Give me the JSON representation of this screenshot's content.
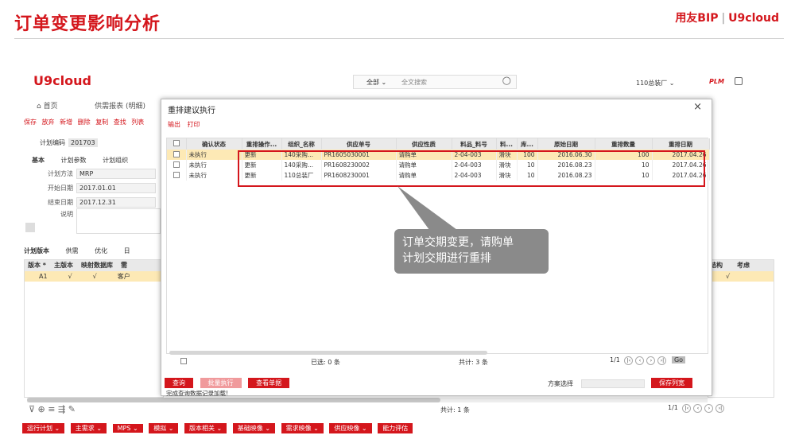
{
  "slide": {
    "title": "订单变更影响分析",
    "brand": "用友BIP",
    "brand_sep": "|",
    "brand2": "U9cloud"
  },
  "app": {
    "logo": "U9cloud",
    "search_scope": "全部 ⌄",
    "search_placeholder": "全文搜索",
    "org": "110总装厂 ⌄",
    "plm": "PLM",
    "nav": [
      "首页",
      "供需报表 (明细)"
    ],
    "toolbar": [
      "保存",
      "放弃",
      "新增",
      "删除",
      "复制",
      "查找",
      "列表"
    ],
    "plan_code_label": "计划编码",
    "plan_code": "201703",
    "tabs1": [
      "基本",
      "计划参数",
      "计划组织"
    ],
    "form": {
      "method_label": "计划方法",
      "method": "MRP",
      "start_label": "开始日期",
      "start": "2017.01.01",
      "end_label": "结束日期",
      "end": "2017.12.31",
      "memo_label": "说明"
    },
    "tabs2": [
      "计划版本",
      "供需",
      "优化",
      "日"
    ],
    "left_grid": {
      "headers": [
        "版本 *",
        "主版本",
        "映射数据库",
        "需"
      ],
      "row": [
        "A1",
        "√",
        "√",
        "客户"
      ]
    },
    "right_grid": {
      "headers": [
        "结构",
        "考虑"
      ],
      "row": [
        "√"
      ]
    },
    "bottom_total": "共计: 1 条",
    "bottom_page": "1/1",
    "bottom_buttons": [
      "运行计划 ⌄",
      "主需求 ⌄",
      "MPS ⌄",
      "模拟 ⌄",
      "版本相关 ⌄",
      "基础映像 ⌄",
      "需求映像 ⌄",
      "供应映像 ⌄",
      "能力评估"
    ]
  },
  "dialog": {
    "title": "重排建议执行",
    "close": "×",
    "tools": [
      "输出",
      "打印"
    ],
    "columns": [
      "",
      "确认状态",
      "重排操作...",
      "组织_名称",
      "供应单号",
      "供应性质",
      "料品_料号",
      "料...",
      "库...",
      "原始日期",
      "重排数量",
      "重排日期"
    ],
    "rows": [
      [
        "",
        "未执行",
        "更新",
        "140采购...",
        "PR1605030001",
        "请购单",
        "2-04-003",
        "滑块",
        "100",
        "2016.06.30",
        "100",
        "2017.04.26"
      ],
      [
        "",
        "未执行",
        "更新",
        "140采购...",
        "PR1608230002",
        "请购单",
        "2-04-003",
        "滑块",
        "10",
        "2016.08.23",
        "10",
        "2017.04.26"
      ],
      [
        "",
        "未执行",
        "更新",
        "110总装厂",
        "PR1608230001",
        "请购单",
        "2-04-003",
        "滑块",
        "10",
        "2016.08.23",
        "10",
        "2017.04.26"
      ]
    ],
    "selected": "已选: 0 条",
    "total": "共计: 3 条",
    "page": "1/1",
    "go": "Go",
    "buttons": [
      "查询",
      "批量执行",
      "查看单据"
    ],
    "scheme_label": "方案选择",
    "save_scheme": "保存列宽",
    "status": "完成查询数据记录加载!"
  },
  "callout": {
    "line1": "订单交期变更，请购单",
    "line2": "计划交期进行重排"
  },
  "colors": {
    "accent": "#d4161c",
    "selected_row": "#fde9b5",
    "callout_bg": "#8a8a8a"
  }
}
